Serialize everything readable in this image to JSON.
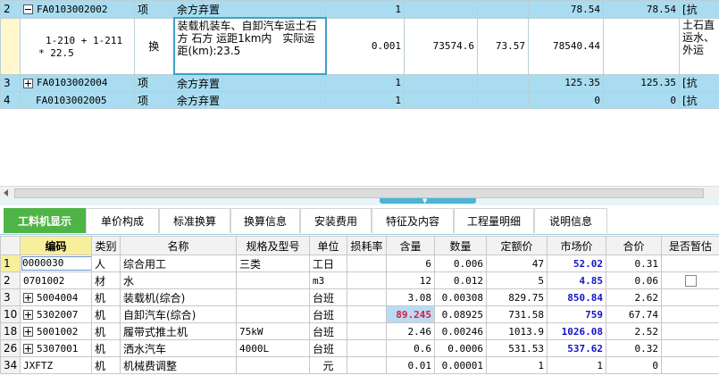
{
  "upper_rows": [
    {
      "row": "2",
      "toggle": "minus",
      "code": "FA0103002002",
      "type": "项",
      "name": "余方弃置",
      "qty": "1",
      "c6": "",
      "c7": "",
      "unit_price": "78.54",
      "total": "78.54",
      "extra": "[抗"
    },
    {
      "row": "",
      "formula_line1": "1-210 + 1-211",
      "formula_line2": "* 22.5",
      "type": "换",
      "desc": "装载机装车、自卸汽车运土石方 石方 运距1km内　实际运距(km):23.5",
      "qty": "0.001",
      "c6": "73574.6",
      "c7": "73.57",
      "unit_price": "78540.44",
      "total": "",
      "extra": "土石直运水、外运"
    },
    {
      "row": "3",
      "toggle": "plus",
      "code": "FA0103002004",
      "type": "项",
      "name": "余方弃置",
      "qty": "1",
      "c6": "",
      "c7": "",
      "unit_price": "125.35",
      "total": "125.35",
      "extra": "[抗"
    },
    {
      "row": "4",
      "toggle": "",
      "code": "FA0103002005",
      "type": "项",
      "name": "余方弃置",
      "qty": "1",
      "c6": "",
      "c7": "",
      "unit_price": "0",
      "total": "0",
      "extra": "[抗"
    }
  ],
  "tabs": [
    "工料机显示",
    "单价构成",
    "标准换算",
    "换算信息",
    "安装费用",
    "特征及内容",
    "工程量明细",
    "说明信息"
  ],
  "lower_headers": [
    "编码",
    "类别",
    "名称",
    "规格及型号",
    "单位",
    "损耗率",
    "含量",
    "数量",
    "定额价",
    "市场价",
    "合价",
    "是否暂估"
  ],
  "lower_rows": [
    {
      "rn": "1",
      "toggle": "",
      "code": "0000030",
      "cat": "人",
      "name": "综合用工",
      "spec": "三类",
      "unit": "工日",
      "loss": "",
      "content": "6",
      "qty": "0.006",
      "quota": "47",
      "market": "52.02",
      "total": "0.31",
      "est": ""
    },
    {
      "rn": "2",
      "toggle": "",
      "code": "0701002",
      "cat": "材",
      "name": "水",
      "spec": "",
      "unit": "m3",
      "loss": "",
      "content": "12",
      "qty": "0.012",
      "quota": "5",
      "market": "4.85",
      "total": "0.06",
      "est": "checkbox"
    },
    {
      "rn": "3",
      "toggle": "plus",
      "code": "5004004",
      "cat": "机",
      "name": "装载机(综合)",
      "spec": "",
      "unit": "台班",
      "loss": "",
      "content": "3.08",
      "qty": "0.00308",
      "quota": "829.75",
      "market": "850.84",
      "total": "2.62",
      "est": ""
    },
    {
      "rn": "10",
      "toggle": "plus",
      "code": "5302007",
      "cat": "机",
      "name": "自卸汽车(综合)",
      "spec": "",
      "unit": "台班",
      "loss": "",
      "content": "89.245",
      "qty": "0.08925",
      "quota": "731.58",
      "market": "759",
      "total": "67.74",
      "est": ""
    },
    {
      "rn": "18",
      "toggle": "plus",
      "code": "5001002",
      "cat": "机",
      "name": "履带式推土机",
      "spec": "75kW",
      "unit": "台班",
      "loss": "",
      "content": "2.46",
      "qty": "0.00246",
      "quota": "1013.9",
      "market": "1026.08",
      "total": "2.52",
      "est": ""
    },
    {
      "rn": "26",
      "toggle": "plus",
      "code": "5307001",
      "cat": "机",
      "name": "洒水汽车",
      "spec": "4000L",
      "unit": "台班",
      "loss": "",
      "content": "0.6",
      "qty": "0.0006",
      "quota": "531.53",
      "market": "537.62",
      "total": "0.32",
      "est": ""
    },
    {
      "rn": "34",
      "toggle": "",
      "code": "JXFTZ",
      "cat": "机",
      "name": "机械费调整",
      "spec": "",
      "unit": "元",
      "loss": "",
      "content": "0.01",
      "qty": "0.00001",
      "quota": "1",
      "market": "1",
      "total": "0",
      "est": ""
    }
  ],
  "colors": {
    "row_blue": "#a9dcf1",
    "tab_active": "#4fb446",
    "header_highlight": "#f8ef9c",
    "market_blue": "#1414c8",
    "content_red": "#e0183c"
  }
}
